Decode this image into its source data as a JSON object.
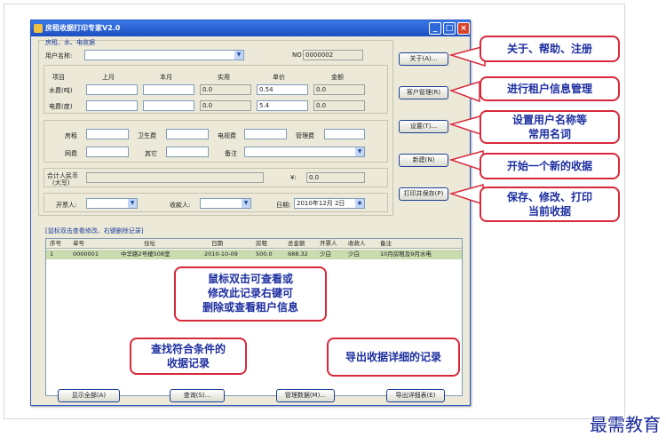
{
  "window": {
    "title": "房租收据打印专家V2.0"
  },
  "form": {
    "section_title": "房租、水、电收据",
    "user_label": "用户名称:",
    "no_label": "NO",
    "no_value": "0000002",
    "headers": {
      "item": "项目",
      "last_month": "上月",
      "this_month": "本月",
      "actual": "实用",
      "price": "单价",
      "amount": "金额"
    },
    "water_label": "水费(吨)",
    "water_actual": "0.0",
    "water_price": "0.54",
    "water_amount": "0.0",
    "power_label": "电费(度)",
    "power_actual": "0.0",
    "power_price": "5.4",
    "power_amount": "0.0",
    "rent_label": "房租",
    "sanitation_label": "卫生费",
    "tv_label": "电视费",
    "mgmt_label": "管理费",
    "gas_label": "网费",
    "other_label": "其它",
    "remark_label": "备注",
    "total_label_1": "合计人民币",
    "total_label_2": "(大写)",
    "yen_label": "¥:",
    "total_value": "0.0",
    "issuer_label": "开票人:",
    "receiver_label": "收款人:",
    "date_label": "日期:",
    "date_value": "2010年12月  2日"
  },
  "buttons": {
    "about": "关于(A)...",
    "customers": "客户管理(R)",
    "settings": "设置(T)...",
    "new": "新建(N)",
    "print_save": "打印并保存(P)",
    "show_all": "显示全部(A)",
    "query": "查询(S)...",
    "manage": "管理数据(M)...",
    "export": "导出详细表(E)"
  },
  "table": {
    "hint": "[鼠标双击查看修改、右键删除记录]",
    "columns": [
      "序号",
      "单号",
      "住址",
      "日期",
      "房租",
      "总金额",
      "开票人",
      "收款人",
      "备注"
    ],
    "rows": [
      [
        "1",
        "0000001",
        "中华路2号楼508室",
        "2010-10-09",
        "500.0",
        "688.32",
        "少白",
        "少白",
        "10月房租及9月水电"
      ]
    ]
  },
  "callouts": {
    "about": "关于、帮助、注册",
    "customers": "进行租户信息管理",
    "settings": "设置用户名称等\n常用名词",
    "new": "开始一个新的收据",
    "print_save": "保存、修改、打印\n当前收据",
    "table": "鼠标双击可查看或\n修改此记录右键可\n删除或查看租户信息",
    "query": "查找符合条件的\n收据记录",
    "export": "导出收据详细的记录"
  },
  "watermark": "最需教育",
  "colors": {
    "callout_border": "#d8283a",
    "callout_text": "#1c2ea0",
    "row_highlight": "#c8dcb0"
  }
}
